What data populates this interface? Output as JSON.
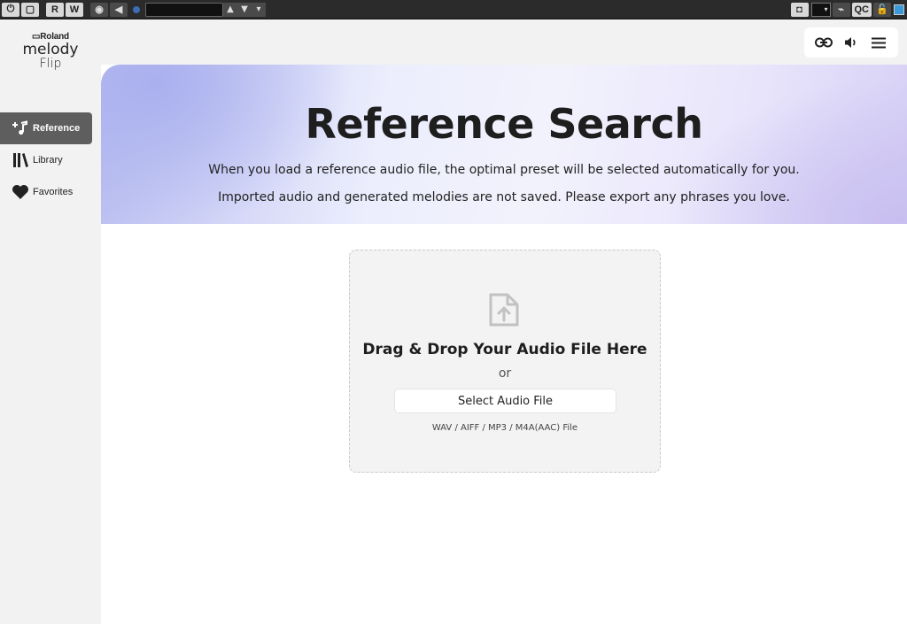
{
  "host_toolbar": {
    "buttons": [
      "R",
      "W"
    ],
    "qc_label": "QC"
  },
  "logo": {
    "brand": "Roland",
    "product_line1": "melody",
    "product_line2": "Flip"
  },
  "sidebar": {
    "items": [
      {
        "label": "Reference",
        "icon": "music-note-plus-icon",
        "active": true
      },
      {
        "label": "Library",
        "icon": "library-books-icon",
        "active": false
      },
      {
        "label": "Favorites",
        "icon": "heart-icon",
        "active": false
      }
    ]
  },
  "toolbar": {
    "icons": [
      "link-icon",
      "volume-icon",
      "hamburger-menu-icon"
    ]
  },
  "hero": {
    "title": "Reference Search",
    "line1": "When you load a reference audio file, the optimal preset will be selected automatically for you.",
    "line2": "Imported audio and generated melodies are not saved. Please export any phrases you love."
  },
  "dropzone": {
    "icon": "file-upload-icon",
    "title": "Drag & Drop Your Audio File Here",
    "or_text": "or",
    "button_label": "Select Audio File",
    "formats": "WAV / AIFF / MP3 / M4A(AAC) File"
  },
  "colors": {
    "active_nav": "#5e5e5e",
    "hero_accent": "#a9b0ee",
    "host_power": "#3a9ad9"
  }
}
